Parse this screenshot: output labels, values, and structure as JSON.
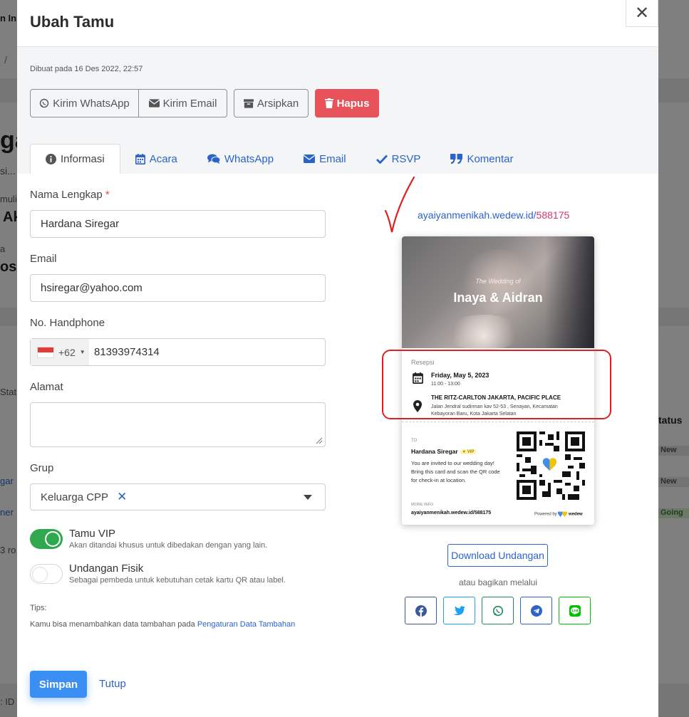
{
  "background": {
    "fragments": [
      "n In",
      "/",
      "ga",
      "si...",
      "muli",
      "Ak",
      "a",
      "osi",
      "Stat",
      "3 ro",
      ": ID"
    ],
    "column_header": "tatus",
    "badges": [
      "New",
      "New",
      "Going"
    ],
    "links": [
      "gar",
      "ner"
    ]
  },
  "modal": {
    "title": "Ubah Tamu",
    "close_label": "✕",
    "created_text": "Dibuat pada 16 Des 2022, 22:57",
    "actions": {
      "whatsapp": "Kirim WhatsApp",
      "email": "Kirim Email",
      "archive": "Arsipkan",
      "delete": "Hapus"
    },
    "tabs": [
      {
        "label": "Informasi",
        "icon": "info-circle-icon",
        "active": true
      },
      {
        "label": "Acara",
        "icon": "calendar-icon",
        "active": false
      },
      {
        "label": "WhatsApp",
        "icon": "chat-bubbles-icon",
        "active": false
      },
      {
        "label": "Email",
        "icon": "envelope-icon",
        "active": false
      },
      {
        "label": "RSVP",
        "icon": "check-icon",
        "active": false
      },
      {
        "label": "Komentar",
        "icon": "quote-icon",
        "active": false
      }
    ]
  },
  "form": {
    "name_label": "Nama Lengkap",
    "required_mark": "*",
    "name_value": "Hardana Siregar",
    "email_label": "Email",
    "email_value": "hsiregar@yahoo.com",
    "phone_label": "No. Handphone",
    "phone_code": "+62",
    "phone_value": "81393974314",
    "address_label": "Alamat",
    "address_value": "",
    "group_label": "Grup",
    "group_value": "Keluarga CPP",
    "group_clear": "✕",
    "vip_title": "Tamu VIP",
    "vip_desc": "Akan ditandai khusus untuk dibedakan dengan yang lain.",
    "vip_on": true,
    "physical_title": "Undangan Fisik",
    "physical_desc": "Sebagai pembeda untuk kebutuhan cetak kartu QR atau label.",
    "physical_on": false,
    "tips_label": "Tips:",
    "tips_text": "Kamu bisa menambahkan data tambahan pada ",
    "tips_link": "Pengaturan Data Tambahan",
    "save": "Simpan",
    "close": "Tutup"
  },
  "invitation": {
    "url_base": "ayaiyanmenikah.wedew.id/",
    "url_id": "588175",
    "card": {
      "subtitle": "The Wedding of",
      "names": "Inaya & Aidran",
      "event_label": "Resepsi",
      "date": "Friday, May 5, 2023",
      "time": "11:00 - 13:00",
      "venue": "THE RITZ-CARLTON JAKARTA, PACIFIC PLACE",
      "address_line1": "Jalan Jendral sudirman kav 52-53 , Senayan, Kecamatan",
      "address_line2": "Kebayoran Baru, Kota Jakarta Selatan",
      "to_label": "TO",
      "guest_name": "Hardana Siregar",
      "vip_badge": "★ VIP",
      "message_line1": "You are invited to our wedding day!",
      "message_line2": "Bring this card and scan the QR code",
      "message_line3": "for check-in at location.",
      "more_info_label": "MORE INFO",
      "footer_url": "ayaiyanmenikah.wedew.id/588175",
      "powered_by": "Powered by",
      "brand": "wedew"
    },
    "download": "Download Undangan",
    "share_text": "atau bagikan melalui",
    "share": [
      {
        "name": "facebook",
        "color": "#3b5998"
      },
      {
        "name": "twitter",
        "color": "#1da1f2"
      },
      {
        "name": "whatsapp",
        "color": "#1f8a52"
      },
      {
        "name": "telegram",
        "color": "#2b63c8"
      },
      {
        "name": "line",
        "color": "#00c300"
      }
    ]
  },
  "colors": {
    "primary": "#3b8ff2",
    "link": "#2b63c8",
    "danger": "#e8525a",
    "toggle_on": "#2fa84f",
    "annotation": "#e02020"
  }
}
